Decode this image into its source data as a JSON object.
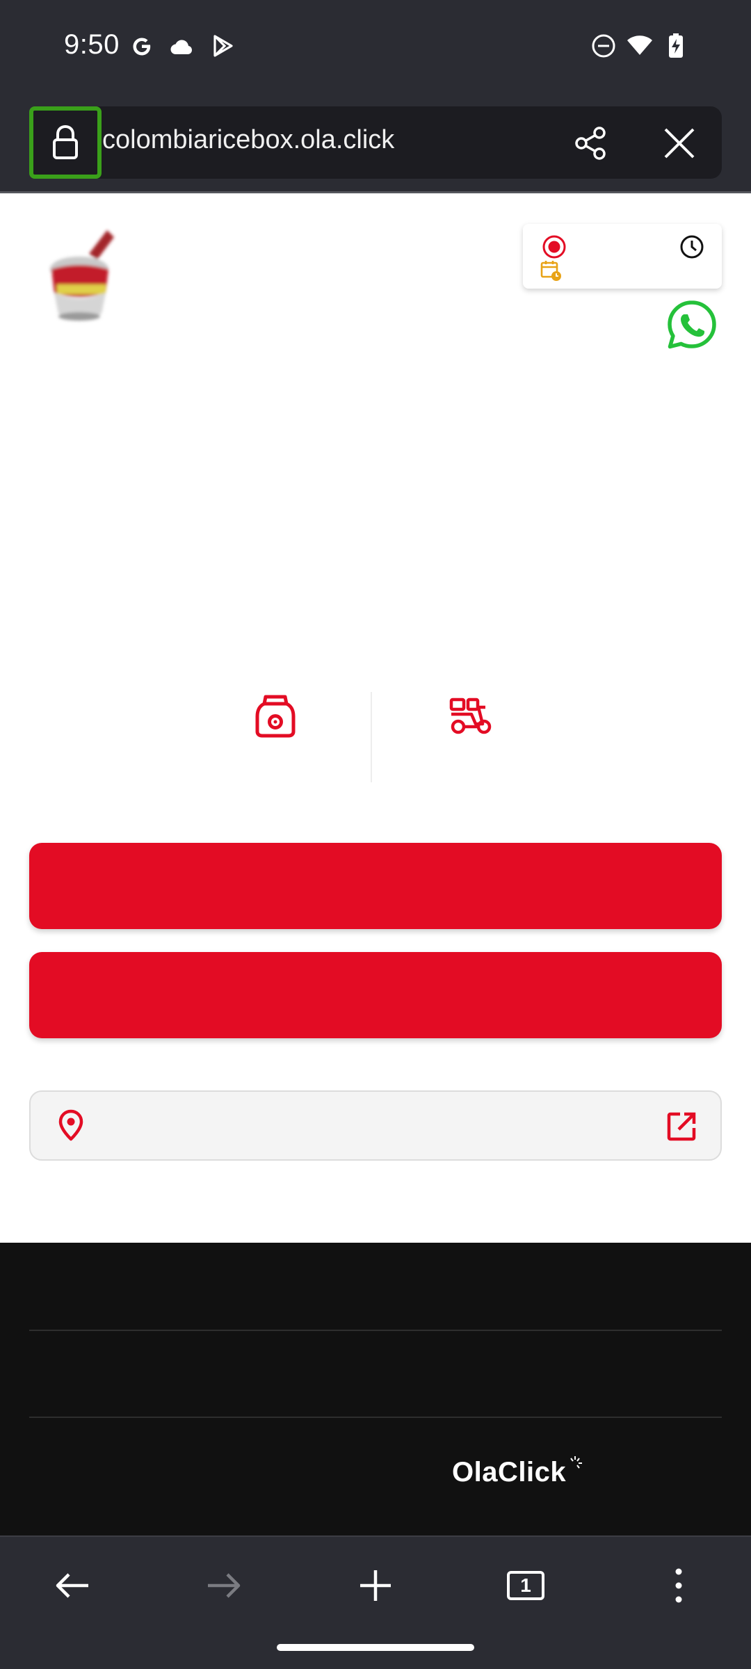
{
  "status_bar": {
    "time": "9:50",
    "left_icons": [
      "google-icon",
      "cloud-icon",
      "play-store-icon"
    ],
    "right_icons": [
      "do-not-disturb-icon",
      "wifi-icon",
      "battery-icon"
    ]
  },
  "browser": {
    "url": "colombiaricebox.ola.click",
    "lock_icon": "lock-icon",
    "share_icon": "share-icon",
    "close_icon": "close-icon"
  },
  "page": {
    "hours_card_icons": [
      "record-icon",
      "calendar-clock-icon",
      "clock-icon"
    ],
    "contact_icon": "whatsapp-icon",
    "order_method_icons": [
      "takeaway-bag-icon",
      "delivery-scooter-icon"
    ],
    "address_icons": [
      "location-pin-icon",
      "external-link-icon"
    ]
  },
  "footer": {
    "brand": "OlaClick"
  },
  "bottom_toolbar": {
    "icons": [
      "back-arrow-icon",
      "forward-arrow-icon",
      "new-tab-icon",
      "tabs-icon",
      "more-menu-icon"
    ],
    "tab_count": "1"
  },
  "colors": {
    "accent_red": "#e30c24",
    "whatsapp_green": "#25c13a",
    "lock_highlight": "#3aa01a",
    "calendar_orange": "#e8a317",
    "chrome_dark": "#2b2c33",
    "footer_black": "#111111"
  }
}
